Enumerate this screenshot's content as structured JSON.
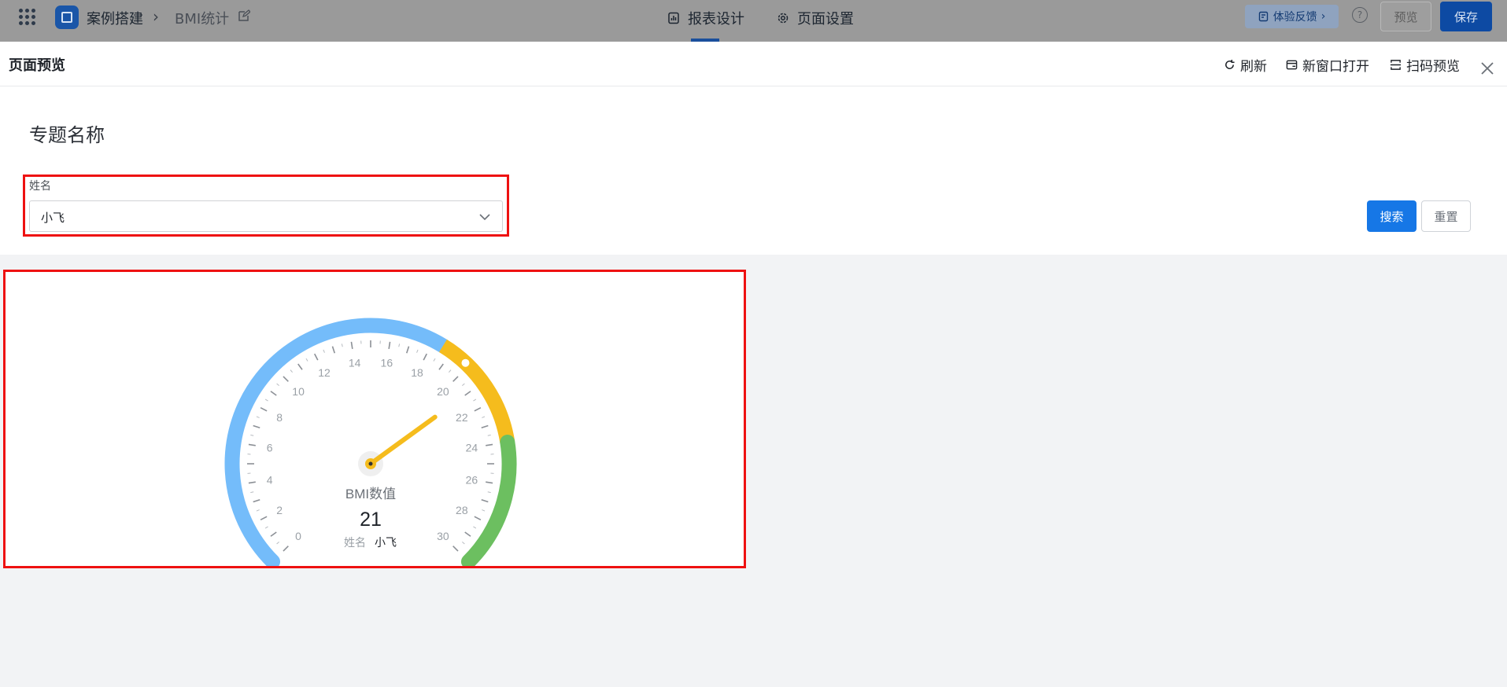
{
  "header": {
    "breadcrumb": [
      "案例搭建",
      "BMI统计"
    ],
    "tabs": [
      {
        "label": "报表设计"
      },
      {
        "label": "页面设置"
      }
    ],
    "feedback_label": "体验反馈",
    "help_label": "?",
    "preview_label": "预览",
    "save_label": "保存"
  },
  "drawer": {
    "title": "页面预览",
    "actions": [
      {
        "label": "刷新"
      },
      {
        "label": "新窗口打开"
      },
      {
        "label": "扫码预览"
      }
    ]
  },
  "filter": {
    "topic_title": "专题名称",
    "field_label": "姓名",
    "selected_value": "小飞",
    "search_label": "搜索",
    "reset_label": "重置"
  },
  "chart_data": {
    "type": "gauge",
    "min": 0,
    "max": 30,
    "value": 21,
    "tick_labels": [
      0,
      2,
      4,
      6,
      8,
      10,
      12,
      14,
      16,
      18,
      20,
      22,
      24,
      26,
      28,
      30
    ],
    "bands": [
      {
        "from": 0,
        "to": 18.5,
        "color": "#74bcfa"
      },
      {
        "from": 18.5,
        "to": 24,
        "color": "#f5bc1d"
      },
      {
        "from": 24,
        "to": 30,
        "color": "#6cbf60"
      }
    ],
    "label": "BMI数值",
    "value_text": "21",
    "caption_key": "姓名",
    "caption_value": "小飞",
    "needle_color": "#f5bc1d"
  }
}
